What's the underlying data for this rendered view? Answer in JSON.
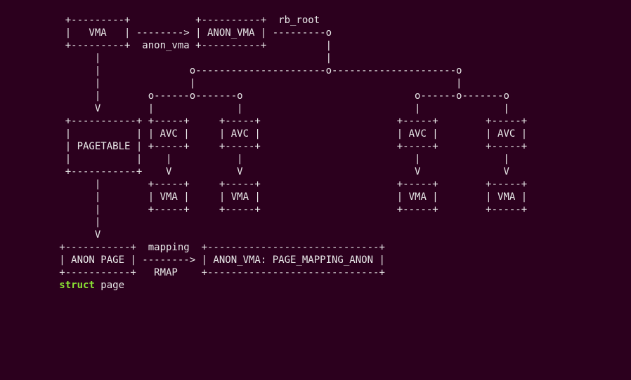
{
  "diagram": {
    "lines": [
      "     +---------+           +----------+  rb_root",
      "     |   VMA   | --------> | ANON_VMA | ---------o",
      "     +---------+  anon_vma +----------+          |",
      "          |                                      |",
      "          |               o----------------------o---------------------o",
      "          |               |                                            |",
      "          |        o------o-------o                             o------o-------o",
      "          V        |              |                             |              |",
      "     +-----------+ +-----+     +-----+                       +-----+        +-----+",
      "     |           | | AVC |     | AVC |                       | AVC |        | AVC |",
      "     | PAGETABLE | +-----+     +-----+                       +-----+        +-----+",
      "     |           |    |           |                             |              |",
      "     +-----------+    V           V                             V              V",
      "          |        +-----+     +-----+                       +-----+        +-----+",
      "          |        | VMA |     | VMA |                       | VMA |        | VMA |",
      "          |        +-----+     +-----+                       +-----+        +-----+",
      "          |",
      "          V",
      "    +-----------+  mapping  +-----------------------------+",
      "    | ANON PAGE | --------> | ANON_VMA: PAGE_MAPPING_ANON |",
      "    +-----------+   RMAP    +-----------------------------+"
    ],
    "footer_keyword": "struct",
    "footer_rest": " page"
  },
  "labels": {
    "vma": "VMA",
    "anon_vma": "ANON_VMA",
    "anon_vma_field": "anon_vma",
    "rb_root": "rb_root",
    "pagetable": "PAGETABLE",
    "avc": "AVC",
    "anon_page": "ANON PAGE",
    "mapping": "mapping",
    "rmap": "RMAP",
    "anon_vma_page_mapping": "ANON_VMA: PAGE_MAPPING_ANON",
    "struct_page": "struct page"
  }
}
